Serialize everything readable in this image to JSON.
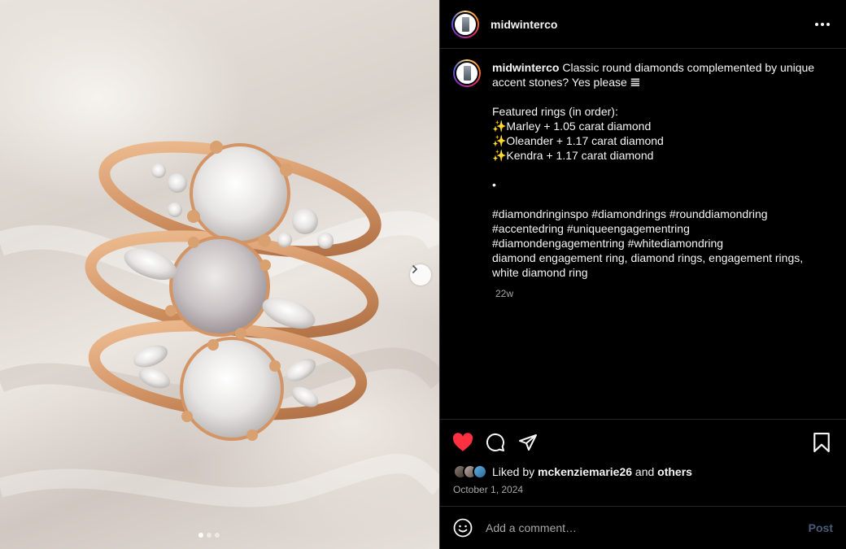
{
  "post": {
    "username": "midwinterco",
    "photo_alt": "Three rose gold engagement rings with round diamonds and accent stones",
    "carousel": {
      "slide_count": 3,
      "current_slide": 1
    }
  },
  "caption": {
    "username": "midwinterco",
    "lines": [
      "Classic round diamonds complemented by unique accent stones? Yes please 𝌆",
      "",
      "Featured rings (in order):",
      "✨Marley + 1.05 carat diamond",
      "✨Oleander + 1.17 carat diamond",
      "✨Kendra + 1.17 carat diamond",
      "",
      "•",
      "",
      "#diamondringinspo #diamondrings #rounddiamondring #accentedring #uniqueengagementring #diamondengagementring #whitediamondring",
      "diamond engagement ring, diamond rings, engagement rings, white diamond ring"
    ],
    "time": "22w"
  },
  "actions": {
    "like_icon": "heart-filled-icon",
    "comment_icon": "comment-icon",
    "share_icon": "send-icon",
    "save_icon": "bookmark-icon",
    "like_color": "#ff3040"
  },
  "likes": {
    "prefix": "Liked by",
    "user": "mckenziemarie26",
    "and": "and",
    "others": "others"
  },
  "date": "October 1, 2024",
  "comment": {
    "placeholder": "Add a comment…",
    "post_label": "Post",
    "emoji_icon": "smiley-icon"
  }
}
